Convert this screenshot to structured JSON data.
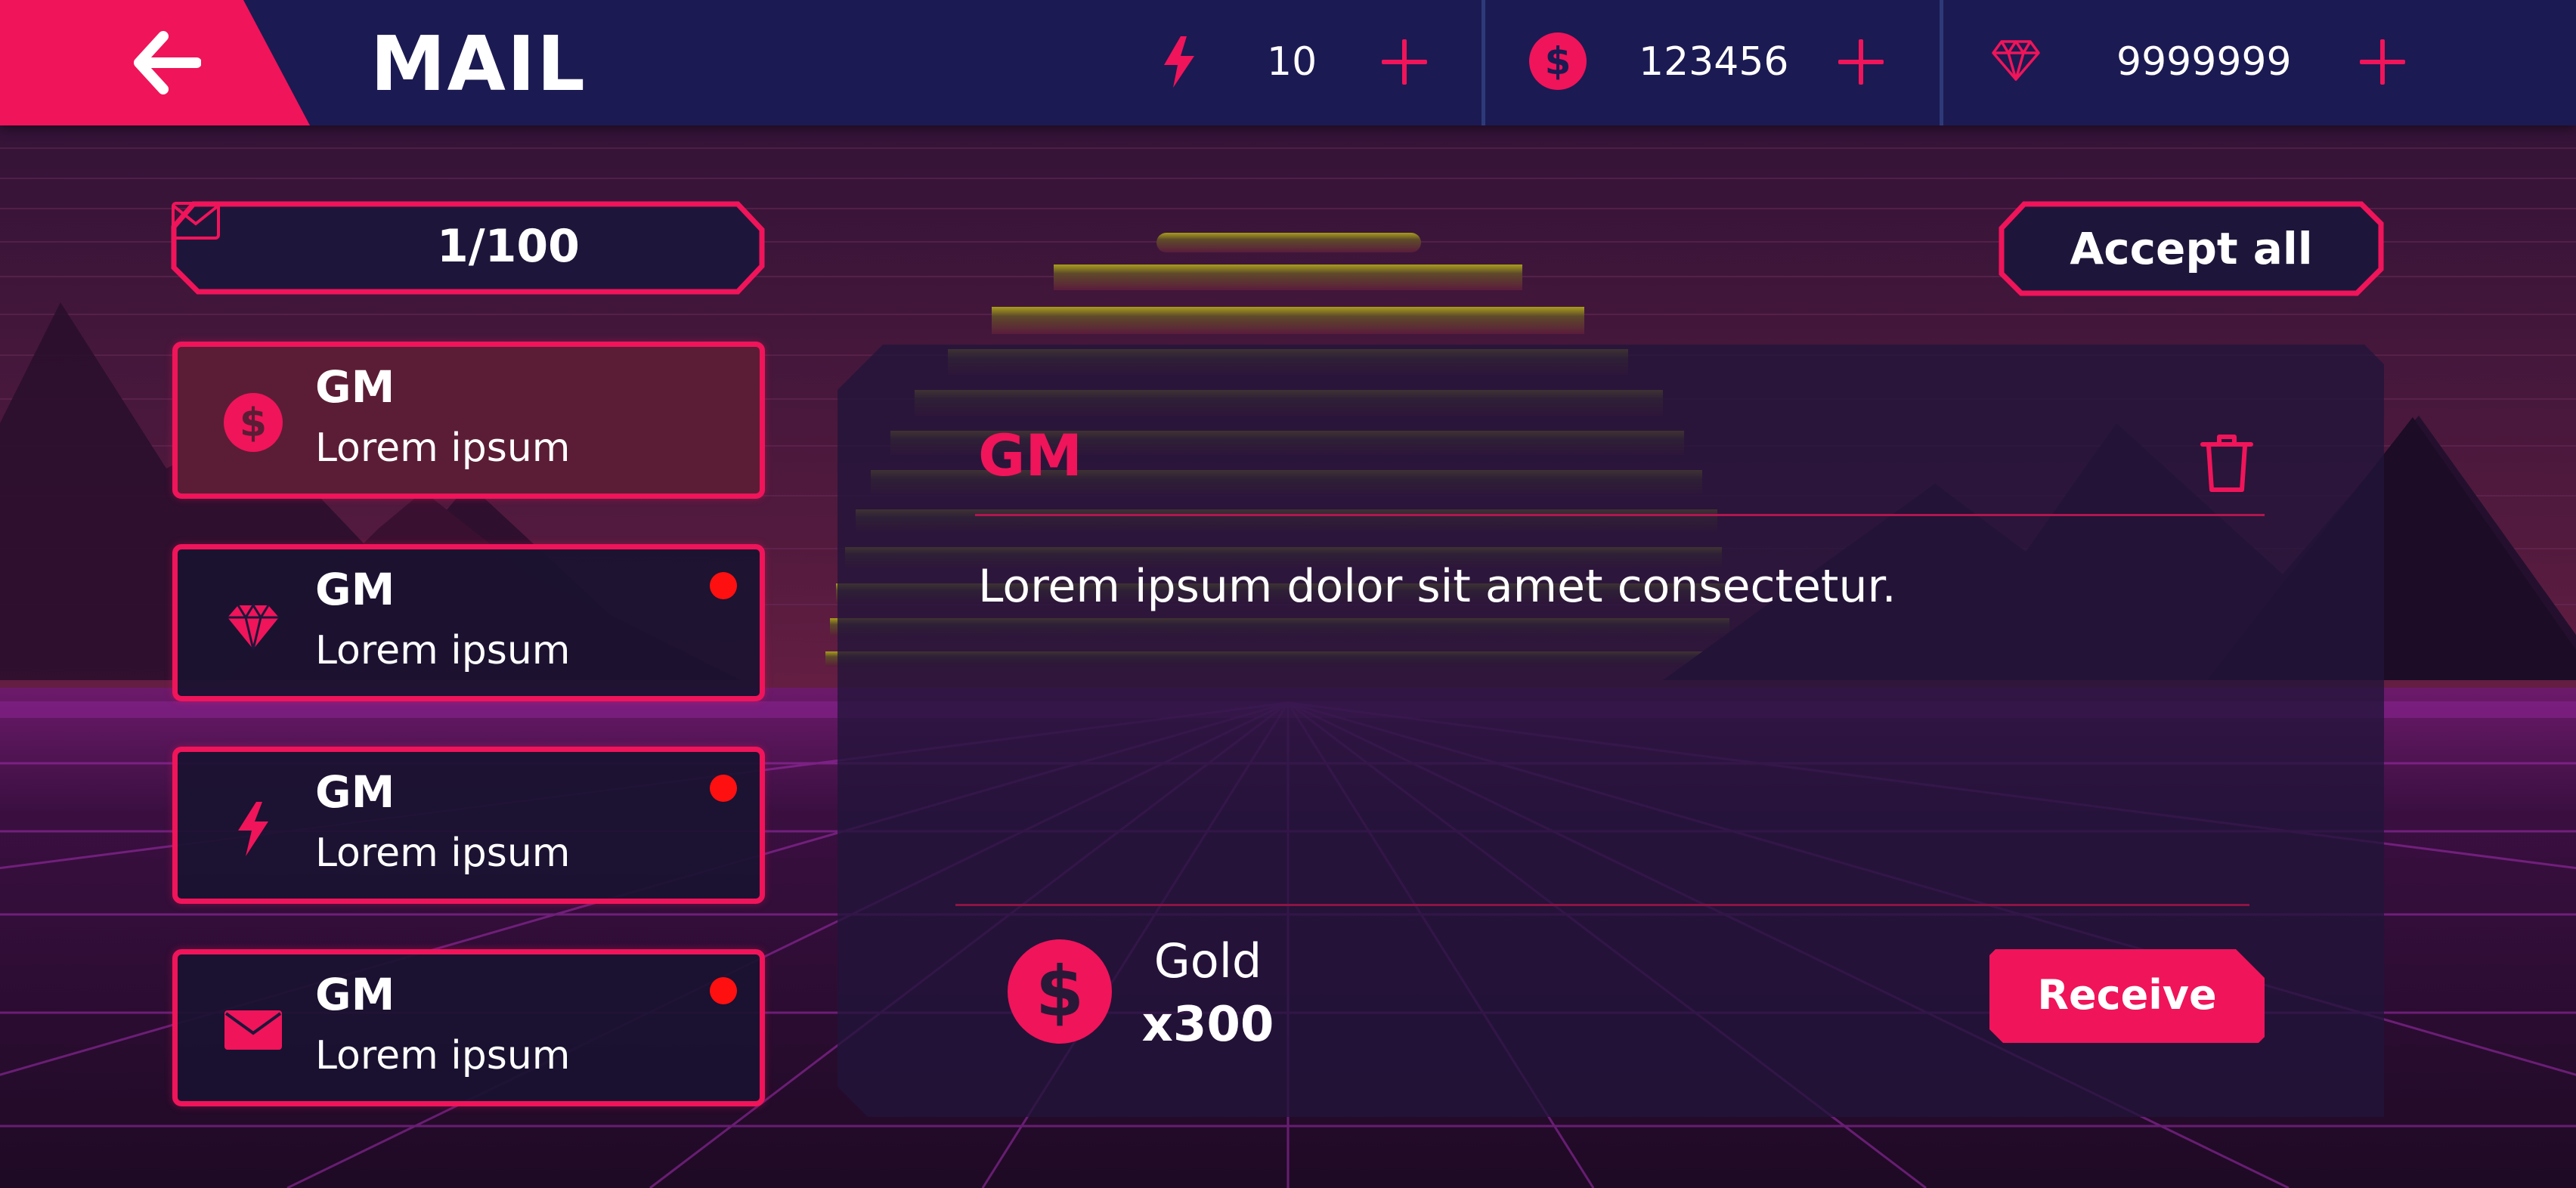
{
  "header": {
    "back_icon": "arrow-left-icon",
    "title": "MAIL",
    "energy": {
      "icon": "lightning-icon",
      "value": "10"
    },
    "gold": {
      "icon": "dollar-coin-icon",
      "value": "123456"
    },
    "gems": {
      "icon": "diamond-icon",
      "value": "9999999"
    }
  },
  "mailbox": {
    "counter_icon": "envelope-outline-icon",
    "counter": "1/100",
    "accept_all_label": "Accept all",
    "items": [
      {
        "icon": "dollar-coin-icon",
        "sender": "GM",
        "subject": "Lorem ipsum",
        "unread": false,
        "selected": true
      },
      {
        "icon": "diamond-icon",
        "sender": "GM",
        "subject": "Lorem ipsum",
        "unread": true,
        "selected": false
      },
      {
        "icon": "lightning-icon",
        "sender": "GM",
        "subject": "Lorem ipsum",
        "unread": true,
        "selected": false
      },
      {
        "icon": "envelope-icon",
        "sender": "GM",
        "subject": "Lorem ipsum",
        "unread": true,
        "selected": false
      }
    ]
  },
  "detail": {
    "sender": "GM",
    "delete_icon": "trash-icon",
    "body": "Lorem ipsum dolor sit amet consectetur.",
    "reward": {
      "icon": "dollar-coin-icon",
      "name": "Gold",
      "quantity": "x300"
    },
    "receive_label": "Receive"
  },
  "colors": {
    "accent": "#f0145a",
    "topbar": "#1c1a52",
    "unread_dot": "#ff1010",
    "selected_item": "#5b1d35",
    "sun": "#a79a1e"
  }
}
